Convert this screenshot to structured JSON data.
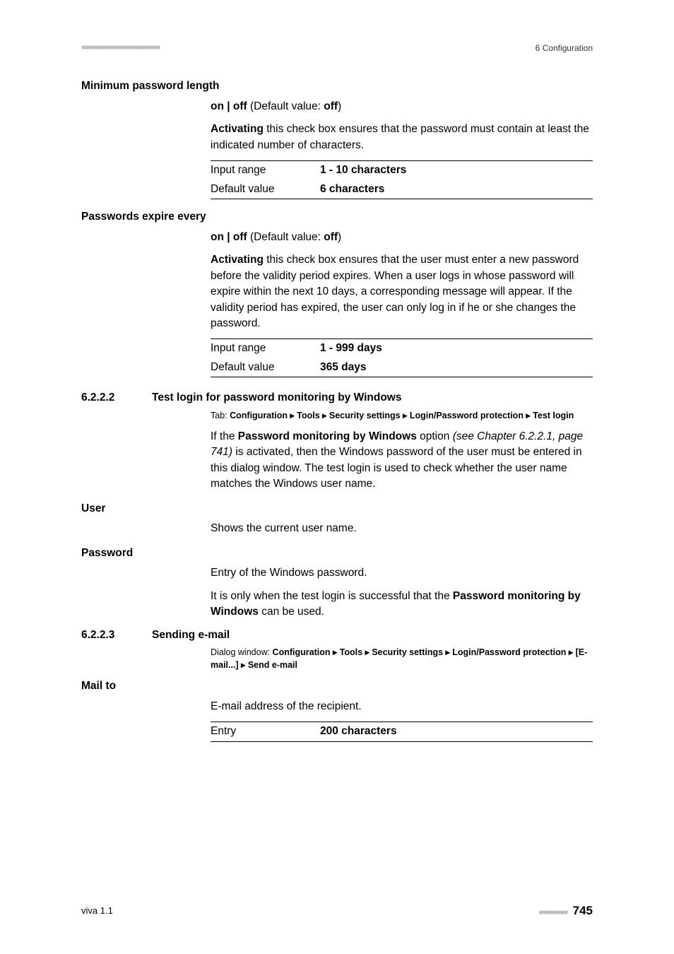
{
  "header": {
    "dots": "■■■■■■■■■■■■■■■■■■■■■■",
    "right": "6 Configuration"
  },
  "minpw": {
    "heading": "Minimum password length",
    "onoff_pre": "on | off",
    "onoff_mid": " (Default value: ",
    "onoff_val": "off",
    "onoff_post": ")",
    "desc_pre": "Activating",
    "desc_rest": " this check box ensures that the password must contain at least the indicated number of characters.",
    "row1a": "Input range",
    "row1b": "1 - 10 characters",
    "row2a": "Default value",
    "row2b": "6 characters"
  },
  "expire": {
    "heading": "Passwords expire every",
    "onoff_pre": "on | off",
    "onoff_mid": " (Default value: ",
    "onoff_val": "off",
    "onoff_post": ")",
    "desc_pre": "Activating",
    "desc_rest": " this check box ensures that the user must enter a new password before the validity period expires. When a user logs in whose password will expire within the next 10 days, a corresponding message will appear. If the validity period has expired, the user can only log in if he or she changes the password.",
    "row1a": "Input range",
    "row1b": "1 - 999 days",
    "row2a": "Default value",
    "row2b": "365 days"
  },
  "sec6222": {
    "num": "6.2.2.2",
    "title": "Test login for password monitoring by Windows",
    "tab_pre": "Tab: ",
    "tab_bold": "Configuration ▸ Tools ▸ Security settings ▸ Login/Password protection ▸ Test login",
    "para_a": "If the ",
    "para_b": "Password monitoring by Windows",
    "para_c": " option ",
    "para_d": "(see Chapter 6.2.2.1, page 741)",
    "para_e": " is activated, then the Windows password of the user must be entered in this dialog window. The test login is used to check whether the user name matches the Windows user name."
  },
  "userblock": {
    "heading": "User",
    "text": "Shows the current user name."
  },
  "pwblock": {
    "heading": "Password",
    "text1": "Entry of the Windows password.",
    "text2_a": "It is only when the test login is successful that the ",
    "text2_b": "Password monitoring by Windows",
    "text2_c": " can be used."
  },
  "sec6223": {
    "num": "6.2.2.3",
    "title": "Sending e-mail",
    "dlg_pre": "Dialog window: ",
    "dlg_bold": "Configuration ▸ Tools ▸ Security settings ▸ Login/Password protection ▸ [E-mail...] ▸ Send e-mail"
  },
  "mailto": {
    "heading": "Mail to",
    "text": "E-mail address of the recipient.",
    "row1a": "Entry",
    "row1b": "200 characters"
  },
  "footer": {
    "left": "viva 1.1",
    "dots": "■■■■■■■■",
    "page": "745"
  }
}
